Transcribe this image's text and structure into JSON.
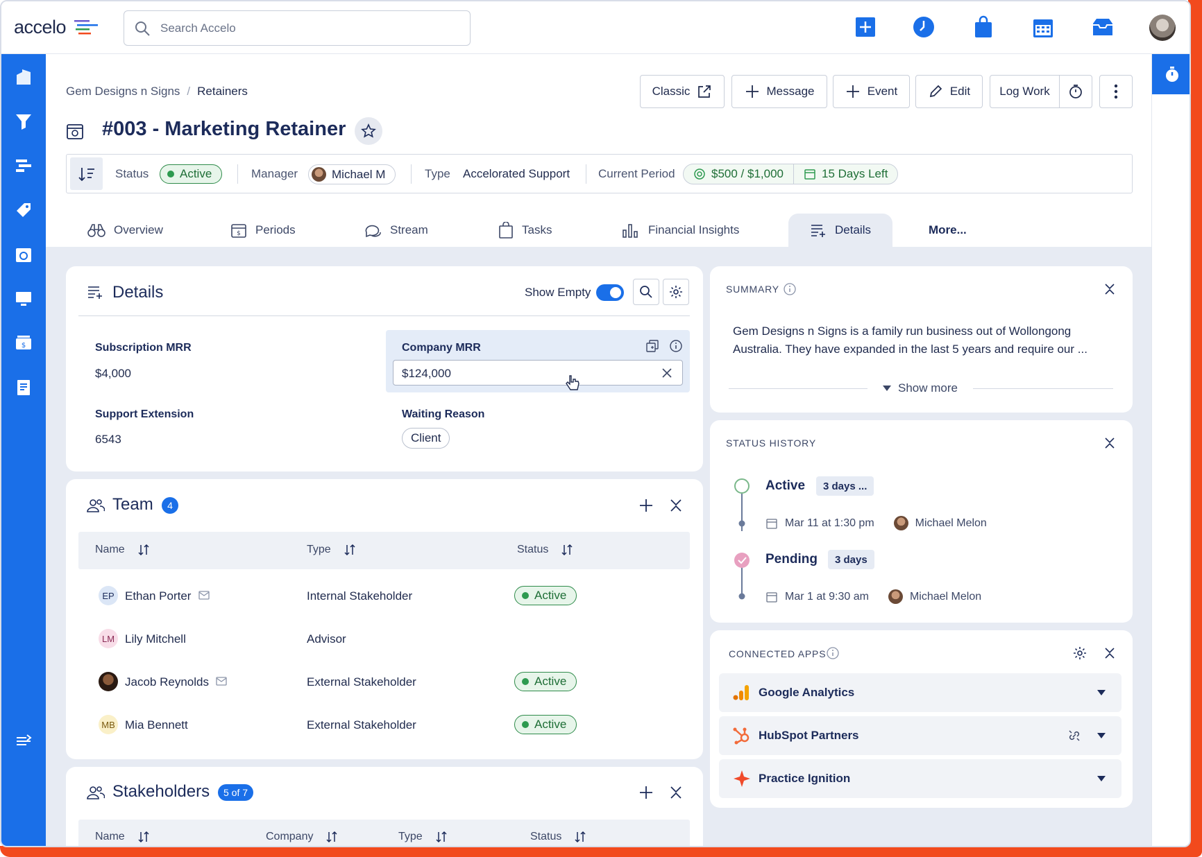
{
  "app": {
    "logo": "accelo",
    "search_placeholder": "Search Accelo"
  },
  "breadcrumb": {
    "parent": "Gem Designs n Signs",
    "current": "Retainers"
  },
  "page": {
    "title": "#003 - Marketing Retainer"
  },
  "actions": {
    "classic": "Classic",
    "message": "Message",
    "event": "Event",
    "edit": "Edit",
    "log_work": "Log Work"
  },
  "statusbar": {
    "status_label": "Status",
    "status_value": "Active",
    "manager_label": "Manager",
    "manager_value": "Michael M",
    "type_label": "Type",
    "type_value": "Accelorated Support",
    "period_label": "Current Period",
    "period_amount": "$500 / $1,000",
    "period_days": "15 Days Left"
  },
  "tabs": [
    "Overview",
    "Periods",
    "Stream",
    "Tasks",
    "Financial Insights",
    "Details",
    "More..."
  ],
  "details": {
    "title": "Details",
    "show_empty": "Show Empty",
    "fields": {
      "subscription_mrr_label": "Subscription MRR",
      "subscription_mrr_value": "$4,000",
      "company_mrr_label": "Company MRR",
      "company_mrr_value": "$124,000",
      "support_ext_label": "Support Extension",
      "support_ext_value": "6543",
      "waiting_reason_label": "Waiting Reason",
      "waiting_reason_value": "Client"
    }
  },
  "team": {
    "title": "Team",
    "count": "4",
    "columns": [
      "Name",
      "Type",
      "Status"
    ],
    "rows": [
      {
        "initials": "EP",
        "name": "Ethan Porter",
        "type": "Internal Stakeholder",
        "status": "Active"
      },
      {
        "initials": "LM",
        "name": "Lily Mitchell",
        "type": "Advisor",
        "status": ""
      },
      {
        "initials": "",
        "name": "Jacob Reynolds",
        "type": "External Stakeholder",
        "status": "Active"
      },
      {
        "initials": "MB",
        "name": "Mia Bennett",
        "type": "External Stakeholder",
        "status": "Active"
      }
    ]
  },
  "stakeholders": {
    "title": "Stakeholders",
    "count": "5 of 7",
    "columns": [
      "Name",
      "Company",
      "Type",
      "Status"
    ]
  },
  "summary": {
    "title": "SUMMARY",
    "line1": "Gem Designs n Signs is a family run business out of Wollongong",
    "line2": "Australia. They have expanded in the last 5 years and require our ...",
    "show_more": "Show more"
  },
  "status_history": {
    "title": "STATUS HISTORY",
    "entries": [
      {
        "status": "Active",
        "duration": "3 days ...",
        "date": "Mar 11 at 1:30 pm",
        "user": "Michael Melon"
      },
      {
        "status": "Pending",
        "duration": "3 days",
        "date": "Mar 1 at 9:30 am",
        "user": "Michael Melon"
      }
    ]
  },
  "connected_apps": {
    "title": "CONNECTED APPS",
    "apps": [
      "Google Analytics",
      "HubSpot Partners",
      "Practice Ignition"
    ]
  },
  "colors": {
    "brand_blue": "#1a6fe8",
    "accent_orange": "#f24a1d",
    "active_green": "#2e9a50"
  }
}
